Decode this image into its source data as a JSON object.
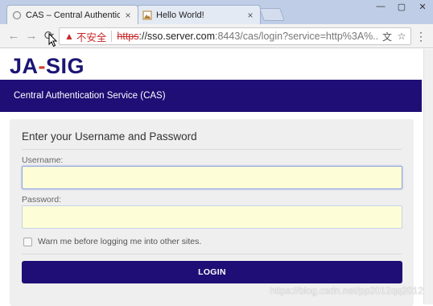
{
  "tabs": [
    {
      "title": "CAS – Central Authentic",
      "close": "×"
    },
    {
      "title": "Hello World!",
      "close": "×"
    }
  ],
  "window": {
    "minimize": "—",
    "maximize": "▢",
    "close": "✕"
  },
  "toolbar": {
    "back": "←",
    "forward": "→",
    "reload": "⟳",
    "security_warning": "▲",
    "insecure_label": "不安全",
    "url_scheme": "https",
    "url_host": "://sso.server.com",
    "url_rest": ":8443/cas/login?service=http%3A%...",
    "translate_icon": "文",
    "bookmark_icon": "☆",
    "menu_icon": "⋮"
  },
  "page": {
    "logo_left": "JA",
    "logo_mid": "-",
    "logo_right": "SIG",
    "banner": "Central Authentication Service (CAS)",
    "card_title": "Enter your Username and Password",
    "username_label": "Username:",
    "username_value": "",
    "password_label": "Password:",
    "password_value": "",
    "warn_label": "Warn me before logging me into other sites.",
    "login_button": "LOGIN",
    "watermark": "https://blog.csdn.net/pp2012qq2012"
  },
  "colors": {
    "brand": "#1f0e75",
    "accent": "#d33b2f",
    "input_bg": "#fdfdd8",
    "insecure": "#c62828"
  }
}
